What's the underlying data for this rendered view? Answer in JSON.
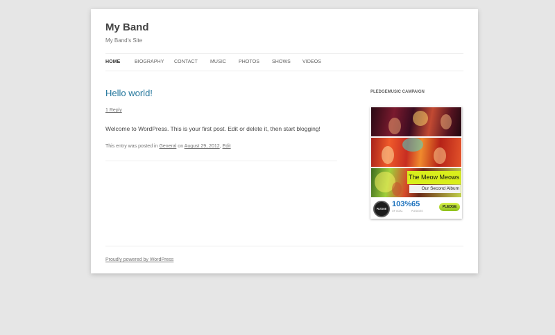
{
  "site": {
    "title": "My Band",
    "description": "My Band's Site"
  },
  "nav": {
    "items": [
      {
        "label": "Home"
      },
      {
        "label": "Biography"
      },
      {
        "label": "Contact"
      },
      {
        "label": "Music"
      },
      {
        "label": "Photos"
      },
      {
        "label": "Shows"
      },
      {
        "label": "Videos"
      }
    ]
  },
  "post": {
    "title": "Hello world!",
    "reply": "1 Reply",
    "content": "Welcome to WordPress. This is your first post. Edit or delete it, then start blogging!",
    "meta_prefix": "This entry was posted in",
    "category": "General",
    "meta_on": "on",
    "date": "August 29, 2012",
    "edit": "Edit"
  },
  "widget": {
    "title": "PledgeMusic Campaign",
    "band_name": "The Meow Meows",
    "album": "Our Second Album",
    "logo": "PLEDGE MUSIC",
    "percent": "103%",
    "percent_label": "of goal",
    "pledges": "65",
    "pledges_label": "pledges",
    "pledge_button": "PLEDGE"
  },
  "footer": {
    "text": "Proudly powered by WordPress"
  }
}
